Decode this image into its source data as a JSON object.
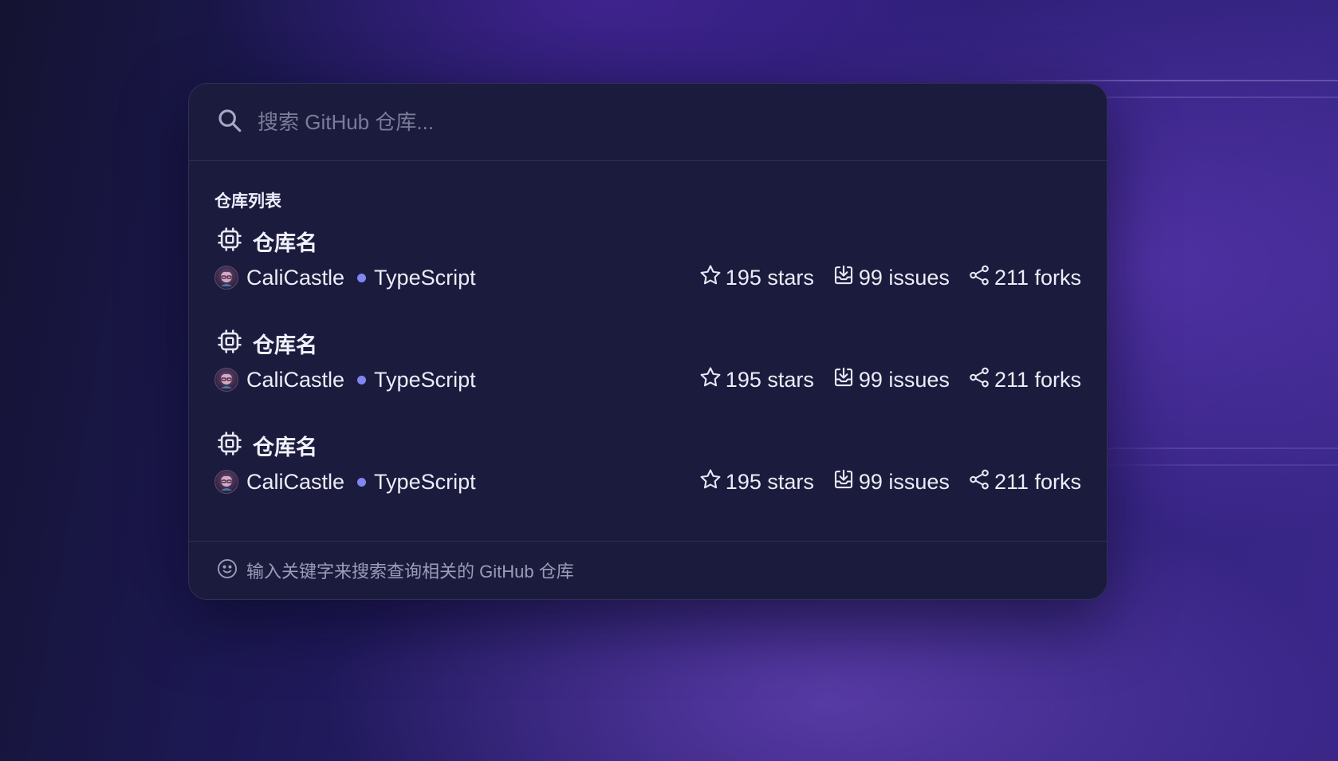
{
  "search": {
    "placeholder": "搜索 GitHub 仓库..."
  },
  "list": {
    "title": "仓库列表",
    "repos": [
      {
        "name": "仓库名",
        "owner": "CaliCastle",
        "language": "TypeScript",
        "stars": "195 stars",
        "issues": "99 issues",
        "forks": "211 forks"
      },
      {
        "name": "仓库名",
        "owner": "CaliCastle",
        "language": "TypeScript",
        "stars": "195 stars",
        "issues": "99 issues",
        "forks": "211 forks"
      },
      {
        "name": "仓库名",
        "owner": "CaliCastle",
        "language": "TypeScript",
        "stars": "195 stars",
        "issues": "99 issues",
        "forks": "211 forks"
      }
    ]
  },
  "footer": {
    "hint": "输入关键字来搜索查询相关的 GitHub 仓库"
  },
  "icons": {
    "search": "search-icon",
    "repo": "cpu-chip-icon",
    "star": "star-icon",
    "issues": "inbox-arrow-down-icon",
    "forks": "share-icon",
    "hint": "smiley-face-icon"
  },
  "colors": {
    "panel": "#1b1b3d",
    "language_dot": "#8286f2",
    "placeholder": "#7b7b9a"
  }
}
